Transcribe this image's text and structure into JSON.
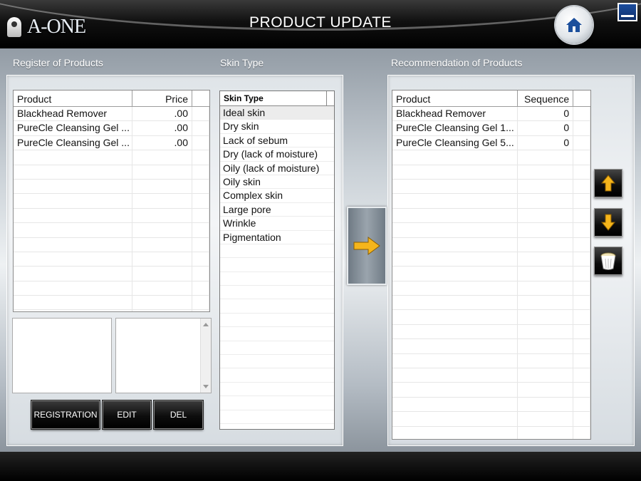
{
  "header": {
    "logo_text": "A-ONE",
    "title": "PRODUCT UPDATE",
    "home_icon": "home-icon",
    "window_icon": "minimize-icon"
  },
  "register": {
    "label": "Register of Products",
    "columns": [
      "Product",
      "Price"
    ],
    "rows": [
      {
        "product": "Blackhead Remover",
        "price": ".00"
      },
      {
        "product": "PureCle Cleansing Gel ...",
        "price": ".00"
      },
      {
        "product": "PureCle Cleansing Gel ...",
        "price": ".00"
      }
    ],
    "buttons": {
      "registration": "REGISTRATION",
      "edit": "EDIT",
      "del": "DEL"
    }
  },
  "skin_type": {
    "label": "Skin Type",
    "column": "Skin Type",
    "items": [
      "Ideal skin",
      "Dry skin",
      "Lack of sebum",
      "Dry (lack of moisture)",
      "Oily (lack of moisture)",
      "Oily skin",
      "Complex skin",
      "Large pore",
      "Wrinkle",
      "Pigmentation"
    ],
    "selected": "Ideal skin"
  },
  "recommendation": {
    "label": "Recommendation of Products",
    "columns": [
      "Product",
      "Sequence"
    ],
    "rows": [
      {
        "product": "Blackhead Remover",
        "sequence": "0"
      },
      {
        "product": "PureCle Cleansing Gel 1...",
        "sequence": "0"
      },
      {
        "product": "PureCle Cleansing Gel 5...",
        "sequence": "0"
      }
    ]
  },
  "icons": {
    "add_arrow": "arrow-right-icon",
    "move_up": "arrow-up-icon",
    "move_down": "arrow-down-icon",
    "delete": "trash-icon"
  },
  "colors": {
    "accent_arrow": "#f5b51b",
    "header_bg": "#000000"
  }
}
